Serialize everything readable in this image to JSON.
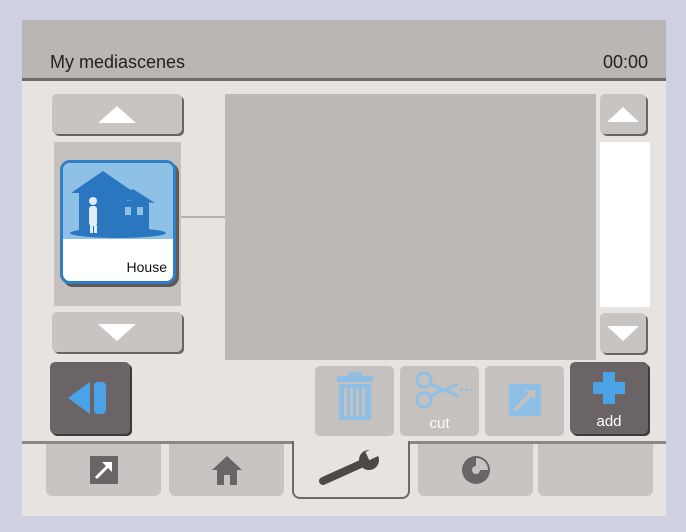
{
  "header": {
    "title": "My mediascenes",
    "time": "00:00"
  },
  "scene_list": {
    "items": [
      {
        "label": "House",
        "icon": "house-person-icon"
      }
    ]
  },
  "toolbar": {
    "delete_icon": "trash-icon",
    "cut_label": "cut",
    "link_icon": "link-arrow-icon",
    "add_label": "add"
  },
  "tabs": [
    {
      "icon": "link-arrow-icon",
      "active": false
    },
    {
      "icon": "home-icon",
      "active": false
    },
    {
      "icon": "wrench-icon",
      "active": true
    },
    {
      "icon": "disc-icon",
      "active": false
    },
    {
      "icon": "",
      "active": false
    }
  ],
  "colors": {
    "accent_blue": "#2f7ec6",
    "tile_image_blue": "#8fc1e6",
    "dark_button": "#6b6467",
    "disabled_icon_blue": "#8fbfe4"
  }
}
